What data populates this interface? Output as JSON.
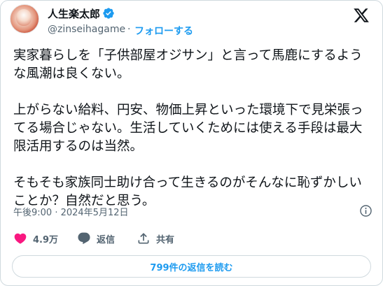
{
  "author": {
    "name": "人生楽太郎",
    "handle": "@zinseihagame",
    "separator": "·",
    "follow_label": "フォローする",
    "verified": true
  },
  "tweet": {
    "text": "実家暮らしを「子供部屋オジサン」と言って馬鹿にするような風潮は良くない。\n\n上がらない給料、円安、物価上昇といった環境下で見栄張ってる場合じゃない。生活していくためには使える手段は最大限活用するのは当然。\n\nそもそも家族同士助け合って生きるのがそんなに恥ずかしいことか？自然だと思う。",
    "timestamp": "午後9:00 · 2024年5月12日"
  },
  "actions": {
    "like_count": "4.9万",
    "reply_label": "返信",
    "share_label": "共有"
  },
  "read_replies_label": "799件の返信を読む",
  "colors": {
    "accent": "#1d9bf0",
    "like": "#f91880",
    "text": "#0f1419",
    "muted": "#536471"
  },
  "icons": {
    "verified": "verified-badge-icon",
    "brand": "x-logo-icon",
    "info": "info-icon",
    "like": "heart-icon",
    "reply": "reply-bubble-icon",
    "share": "share-upload-icon"
  }
}
